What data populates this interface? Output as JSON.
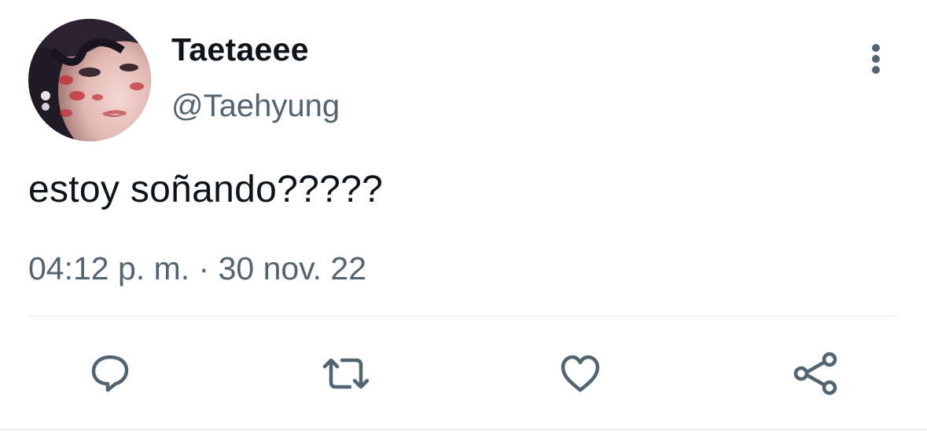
{
  "tweet": {
    "author": {
      "display_name": "Taetaeee",
      "handle": "@Taehyung",
      "avatar_icon": "profile-photo"
    },
    "text": "estoy soñando?????",
    "timestamp": {
      "time": "04:12 p. m.",
      "separator": "·",
      "date": "30 nov. 22"
    },
    "actions": [
      {
        "name": "reply",
        "icon": "speech-bubble-icon"
      },
      {
        "name": "retweet",
        "icon": "retweet-arrows-icon"
      },
      {
        "name": "like",
        "icon": "heart-icon"
      },
      {
        "name": "share",
        "icon": "share-nodes-icon"
      }
    ],
    "more_icon": "vertical-ellipsis-icon"
  },
  "colors": {
    "primary_text": "#0f1419",
    "secondary_text": "#536471",
    "divider": "#eff3f4",
    "background": "#ffffff"
  }
}
